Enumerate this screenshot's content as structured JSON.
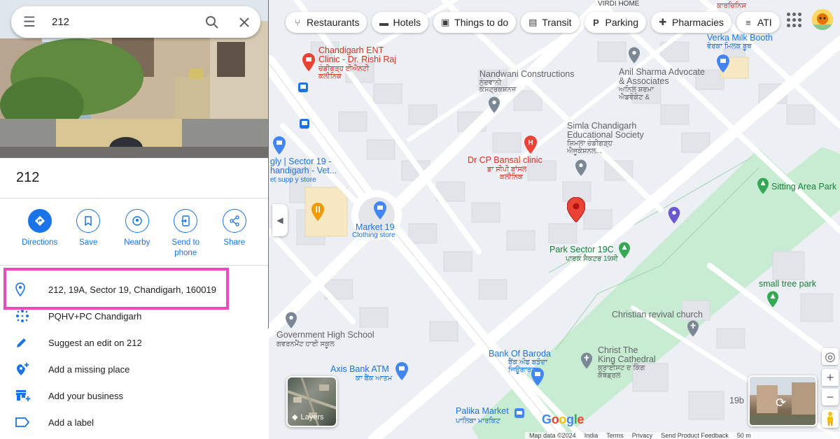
{
  "search": {
    "value": "212",
    "menu_icon": "hamburger-menu-icon",
    "search_icon": "search-icon",
    "close_icon": "close-icon"
  },
  "place": {
    "title": "212"
  },
  "actions": [
    {
      "label": "Directions",
      "icon": "directions-icon"
    },
    {
      "label": "Save",
      "icon": "bookmark-icon"
    },
    {
      "label": "Nearby",
      "icon": "nearby-icon"
    },
    {
      "label": "Send to phone",
      "icon": "send-to-phone-icon"
    },
    {
      "label": "Share",
      "icon": "share-icon"
    }
  ],
  "details": [
    {
      "text": "212, 19A, Sector 19, Chandigarh, 160019",
      "icon": "location-pin-icon"
    },
    {
      "text": "PQHV+PC Chandigarh",
      "icon": "plus-code-icon"
    },
    {
      "text": "Suggest an edit on 212",
      "icon": "edit-pencil-icon"
    },
    {
      "text": "Add a missing place",
      "icon": "add-place-icon"
    },
    {
      "text": "Add your business",
      "icon": "add-business-icon"
    },
    {
      "text": "Add a label",
      "icon": "label-icon"
    }
  ],
  "chips": [
    {
      "label": "Restaurants",
      "icon": "fork-knife-icon"
    },
    {
      "label": "Hotels",
      "icon": "bed-icon"
    },
    {
      "label": "Things to do",
      "icon": "camera-icon"
    },
    {
      "label": "Transit",
      "icon": "train-icon"
    },
    {
      "label": "Parking",
      "icon": "parking-icon"
    },
    {
      "label": "Pharmacies",
      "icon": "pharmacy-icon"
    },
    {
      "label": "ATI",
      "icon": "atm-icon"
    }
  ],
  "map_labels": {
    "virdi_home": "VIRDI HOME",
    "virdi_home_pa": "ਕਾਰਚਿਨਿਸ",
    "chandigarh_ent_1": "Chandigarh ENT",
    "chandigarh_ent_2": "Clinic - Dr. Rishi Raj",
    "chandigarh_ent_pa1": "ਚੰਡੀਗੜ੍ਹ ਈਐਨਟੀ",
    "chandigarh_ent_pa2": "ਕਲੀਨਿਕ",
    "verka": "Verka Milk Booth",
    "verka_pa": "ਵੇਰਕਾ ਮਿਲਕ ਬੂਥ",
    "nandwani": "Nandwani Constructions",
    "nandwani_pa": "ਨੰਦਵਾਨੀ",
    "nandwani_pa2": "ਕੰਸਟ੍ਰਕਸ਼ਨਜ਼",
    "anil_1": "Anil Sharma Advocate",
    "anil_2": "& Associates",
    "anil_pa1": "ਅਨਿਲ ਸ਼ਰਮਾ",
    "anil_pa2": "ਐਡਵੋਕੇਟ &",
    "simla_1": "Simla Chandigarh",
    "simla_2": "Educational Society",
    "simla_pa1": "ਸ਼ਿਮਲਾ ਚੰਡੀਗੜ੍ਹ",
    "simla_pa2": "ਐਜੂਕੇਸ਼ਨਲ...",
    "sector19_1": "gly | Sector 19 -",
    "sector19_2": "handigarh - Vet...",
    "sector19_3": "et supp y store",
    "cp_bansal": "Dr CP Bansal clinic",
    "cp_bansal_pa1": "ਡਾ ਸੀਪੀ ਬਾਂਸਲ",
    "cp_bansal_pa2": "ਕਲੀਨਿਕ",
    "sitting_area": "Sitting Area Park",
    "market19_1": "Market 19",
    "market19_2": "Clothing store",
    "park19c": "Park Sector 19C",
    "park19c_pa": "ਪਾਰਕ ਸੈਕਟਰ 19ਸੀ",
    "small_tree": "small tree park",
    "christian": "Christian revival church",
    "govt_school": "Government High School",
    "govt_school_pa": "ਗਵਰਨਮੈਂਟ ਹਾਈ ਸਕੂਲ",
    "axis": "Axis Bank ATM",
    "axis_pa": "ਕਾ ਬੈਂਕ ਆਤਮ",
    "baroda": "Bank Of Baroda",
    "baroda_pa1": "ਬੈਂਕ ਔਫ ਬੜੌਦਾ",
    "baroda_pa2": "ਜਿਊਗਾਰਨ",
    "christ_king_1": "Christ The",
    "christ_king_2": "King Cathedral",
    "christ_king_pa1": "ਕ੍ਰਾਈਸਟ ਦ ਕਿੰਗ",
    "christ_king_pa2": "ਕੈਥੇਡ੍ਰਲ",
    "palika": "Palika Market",
    "palika_pa": "ਪਾਲਿਕਾ ਮਾਰਕਿਟ",
    "label_19b": "19b"
  },
  "layers_label": "Layers",
  "google_logo": "Google",
  "footer": {
    "map_data": "Map data ©2024",
    "india": "India",
    "terms": "Terms",
    "privacy": "Privacy",
    "feedback": "Send Product Feedback",
    "scale": "50 m"
  },
  "colors": {
    "accent": "#1a73e8",
    "highlight": "#ec4bc0",
    "park": "#c8ecd2",
    "pin_red": "#ea4335"
  }
}
